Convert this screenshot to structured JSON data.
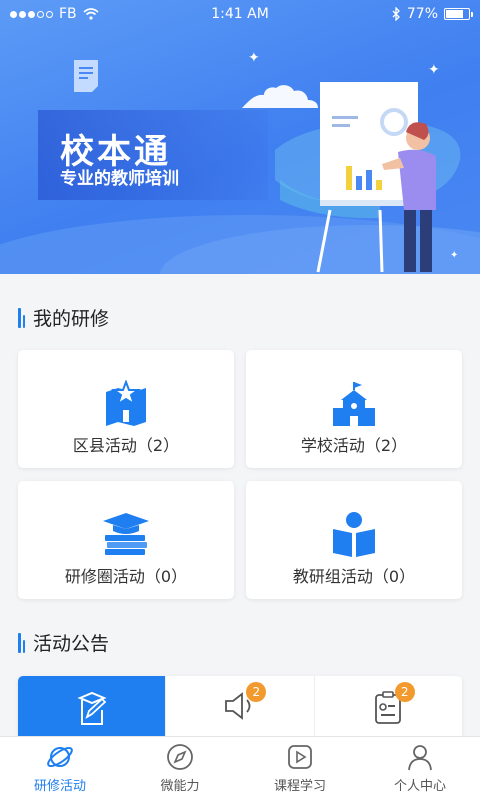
{
  "status_bar": {
    "carrier": "FB",
    "time": "1:41 AM",
    "battery": "77%",
    "battery_level": 0.77
  },
  "banner": {
    "title": "校本通",
    "subtitle": "专业的教师培训"
  },
  "my_training": {
    "title": "我的研修",
    "cards": [
      {
        "label": "区县活动（2）",
        "icon": "district-star-icon"
      },
      {
        "label": "学校活动（2）",
        "icon": "school-building-icon"
      },
      {
        "label": "研修圈活动（0）",
        "icon": "books-graduation-cap-icon"
      },
      {
        "label": "教研组活动（0）",
        "icon": "reading-person-icon"
      }
    ]
  },
  "announcements": {
    "title": "活动公告",
    "tabs": [
      {
        "icon": "edit-document-icon",
        "badge": ""
      },
      {
        "icon": "speaker-icon",
        "badge": "2"
      },
      {
        "icon": "notice-board-icon",
        "badge": "2"
      }
    ]
  },
  "tabbar": {
    "items": [
      {
        "label": "研修活动",
        "icon": "planet-icon"
      },
      {
        "label": "微能力",
        "icon": "compass-icon"
      },
      {
        "label": "课程学习",
        "icon": "play-icon"
      },
      {
        "label": "个人中心",
        "icon": "person-icon"
      }
    ]
  },
  "colors": {
    "primary": "#1f7ff0",
    "badge": "#f39a2f",
    "banner": "#4a88f3"
  }
}
